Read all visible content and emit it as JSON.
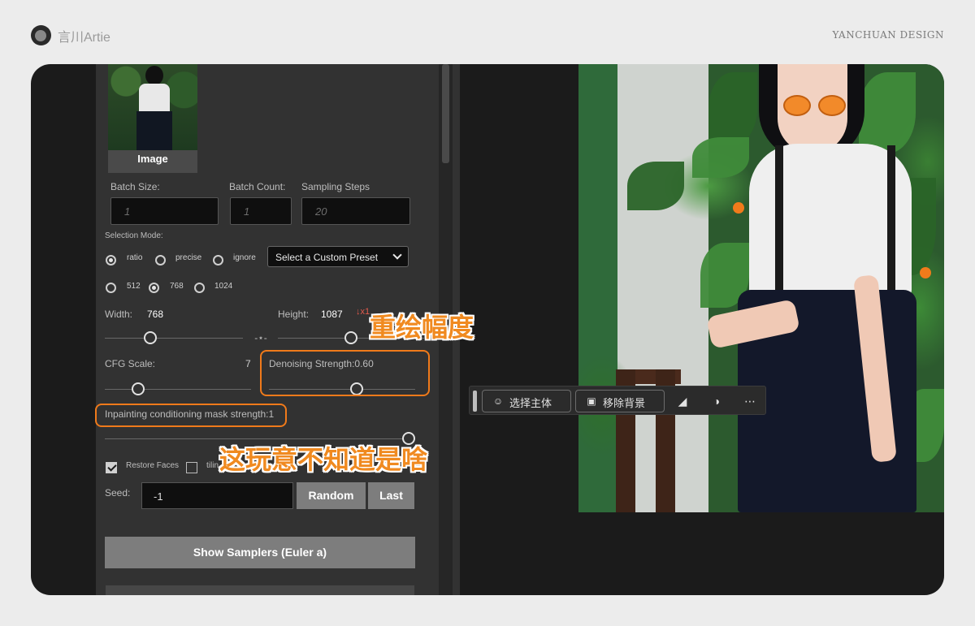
{
  "header": {
    "brand_name": "言川Artie",
    "design_label": "YANCHUAN DESIGN"
  },
  "panel": {
    "thumbnail_label": "Image",
    "batch_size": {
      "label": "Batch Size:",
      "placeholder": "1"
    },
    "batch_count": {
      "label": "Batch Count:",
      "placeholder": "1"
    },
    "sampling_steps": {
      "label": "Sampling Steps",
      "placeholder": "20"
    },
    "selection_mode": {
      "label": "Selection Mode:",
      "options": [
        "ratio",
        "precise",
        "ignore"
      ],
      "selected": "ratio"
    },
    "preset_select": {
      "value": "Select a Custom Preset"
    },
    "size_options": {
      "options": [
        "512",
        "768",
        "1024"
      ],
      "selected": "768"
    },
    "width": {
      "label": "Width:",
      "value": "768",
      "slider_fraction": 0.33
    },
    "height": {
      "label": "Height:",
      "value": "1087",
      "hint": "↓x1",
      "slider_fraction": 0.5
    },
    "cfg_scale": {
      "label": "CFG Scale:",
      "value": "7",
      "slider_fraction": 0.23
    },
    "denoising": {
      "label": "Denoising Strength:0.60",
      "slider_fraction": 0.6
    },
    "inpainting": {
      "label": "Inpainting conditioning mask strength:1",
      "slider_fraction": 1.0
    },
    "checkboxes": [
      {
        "label": "Restore Faces",
        "checked": true
      },
      {
        "label": "tilin",
        "checked": false
      }
    ],
    "seed": {
      "label": "Seed:",
      "value": "-1"
    },
    "random_label": "Random",
    "last_label": "Last",
    "show_samplers_label": "Show Samplers (Euler a)"
  },
  "annotations": {
    "denoising_callout": "重绘幅度",
    "inpainting_callout": "这玩意不知道是啥",
    "accent_color": "#f07a1a"
  },
  "toolbar": {
    "select_subject_label": "选择主体",
    "remove_bg_label": "移除背景",
    "icons": [
      "person-icon",
      "image-icon",
      "crop-icon",
      "contrast-icon",
      "more-icon"
    ]
  }
}
